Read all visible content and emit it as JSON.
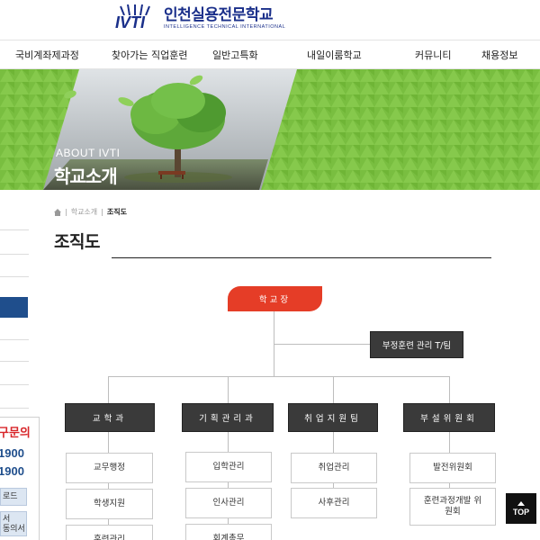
{
  "header": {
    "logo_mark": "IVTI",
    "logo_korean": "인천실용전문학교",
    "logo_english": "INTELLIGENCE TECHNICAL INTERNATIONAL"
  },
  "nav": {
    "items": [
      "국비계좌제과정",
      "찾아가는 직업훈련",
      "일반고특화",
      "내일이룸학교",
      "커뮤니티",
      "채용정보"
    ]
  },
  "banner": {
    "subtitle_en": "ABOUT IVTI",
    "title_ko": "학교소개"
  },
  "sidebar": {
    "inquiry_label": "구문의",
    "phone_1": "1900",
    "phone_2": "1900",
    "btn_1": "로드",
    "btn_2_line1": "서",
    "btn_2_line2": "동의서"
  },
  "breadcrumb": {
    "home_icon": "home-icon",
    "parent": "학교소개",
    "current": "조직도"
  },
  "page": {
    "title": "조직도"
  },
  "org_chart": {
    "top": "학교장",
    "side": "부정훈련 관리 T/팀",
    "departments": [
      {
        "name": "교학과",
        "children": [
          "교무행정",
          "학생지원",
          "훈련관리"
        ]
      },
      {
        "name": "기획관리과",
        "children": [
          "입학관리",
          "인사관리",
          "회계총무"
        ]
      },
      {
        "name": "취업지원팀",
        "children": [
          "취업관리",
          "사후관리"
        ]
      },
      {
        "name": "부설위원회",
        "children": [
          "발전위원회",
          "훈련과정개발 위원회"
        ]
      }
    ]
  },
  "top_button": {
    "label": "TOP"
  },
  "colors": {
    "brand_blue": "#1a2f8a",
    "banner_green": "#7bc043",
    "head_red": "#e53d27",
    "dept_dark": "#3a3a3a",
    "sidebar_blue": "#1f4e8c"
  }
}
